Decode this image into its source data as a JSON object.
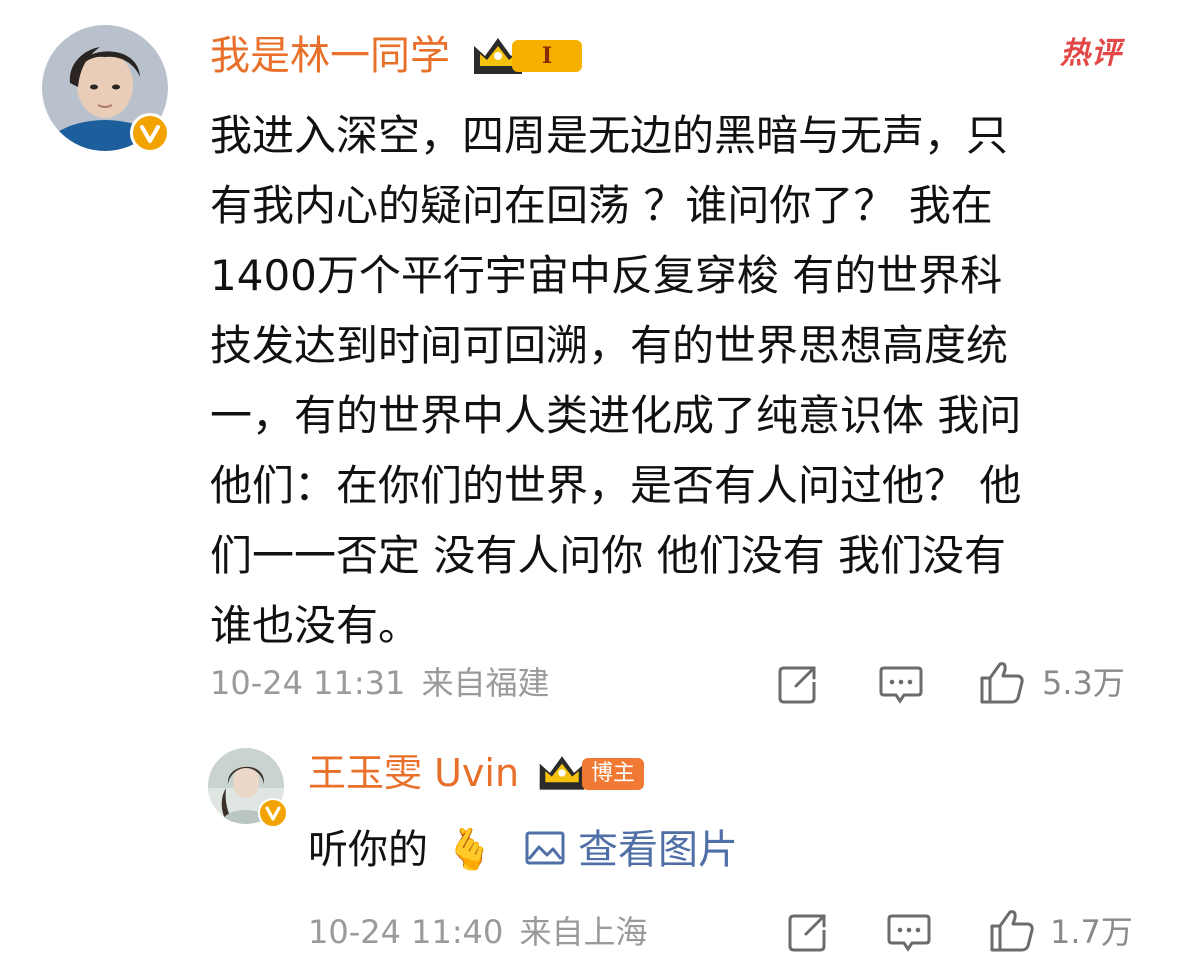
{
  "hot_label": "热评",
  "comments": [
    {
      "username": "我是林一同学",
      "level": "I",
      "text": "我进入深空，四周是无边的黑暗与无声，只有我内心的疑问在回荡 ？谁问你了？ 我在1400万个平行宇宙中反复穿梭 有的世界科技发达到时间可回溯，有的世界思想高度统一，有的世界中人类进化成了纯意识体 我问他们：在你们的世界，是否有人问过他？ 他们一一否定 没有人问你 他们没有 我们没有谁也没有。",
      "lines": [
        "我进入深空，四周是无边的黑暗与无声，只",
        "有我内心的疑问在回荡 ？谁问你了？ 我在",
        "1400万个平行宇宙中反复穿梭 有的世界科",
        "技发达到时间可回溯，有的世界思想高度统",
        "一，有的世界中人类进化成了纯意识体 我问",
        "他们：在你们的世界，是否有人问过他？ 他",
        "们一一否定 没有人问你 他们没有 我们没有",
        "谁也没有。"
      ],
      "timestamp": "10-24 11:31",
      "location": "来自福建",
      "likes": "5.3万"
    },
    {
      "username": "王玉雯 Uvin",
      "tag": "博主",
      "text": "听你的",
      "emoji": "🫰",
      "view_image_label": "查看图片",
      "timestamp": "10-24 11:40",
      "location": "来自上海",
      "likes": "1.7万"
    }
  ],
  "colors": {
    "username": "#e8702a",
    "hot": "#e24848",
    "link": "#4f6fa6",
    "meta": "#9a9a9a",
    "verified": "#f3a300"
  },
  "icons": [
    "share-icon",
    "comment-icon",
    "like-icon",
    "picture-icon",
    "crown-icon",
    "verified-icon"
  ]
}
